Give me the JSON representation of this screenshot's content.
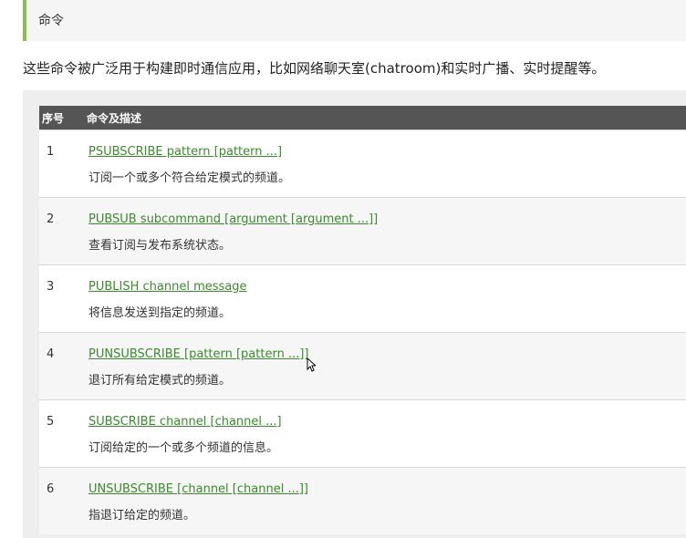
{
  "section": {
    "title": "命令",
    "accent_color": "#8fbe4f"
  },
  "intro_text": "这些命令被广泛用于构建即时通信应用，比如网络聊天室(chatroom)和实时广播、实时提醒等。",
  "table": {
    "headers": {
      "index": "序号",
      "description": "命令及描述"
    },
    "link_color": "#3c8a2e",
    "rows": [
      {
        "index": "1",
        "command": "PSUBSCRIBE pattern [pattern ...]",
        "description": "订阅一个或多个符合给定模式的频道。"
      },
      {
        "index": "2",
        "command": "PUBSUB subcommand [argument [argument ...]]",
        "description": "查看订阅与发布系统状态。"
      },
      {
        "index": "3",
        "command": "PUBLISH channel message",
        "description": "将信息发送到指定的频道。"
      },
      {
        "index": "4",
        "command": "PUNSUBSCRIBE [pattern [pattern ...]]",
        "description": "退订所有给定模式的频道。"
      },
      {
        "index": "5",
        "command": "SUBSCRIBE channel [channel ...]",
        "description": "订阅给定的一个或多个频道的信息。"
      },
      {
        "index": "6",
        "command": "UNSUBSCRIBE [channel [channel ...]]",
        "description": "指退订给定的频道。"
      }
    ]
  }
}
